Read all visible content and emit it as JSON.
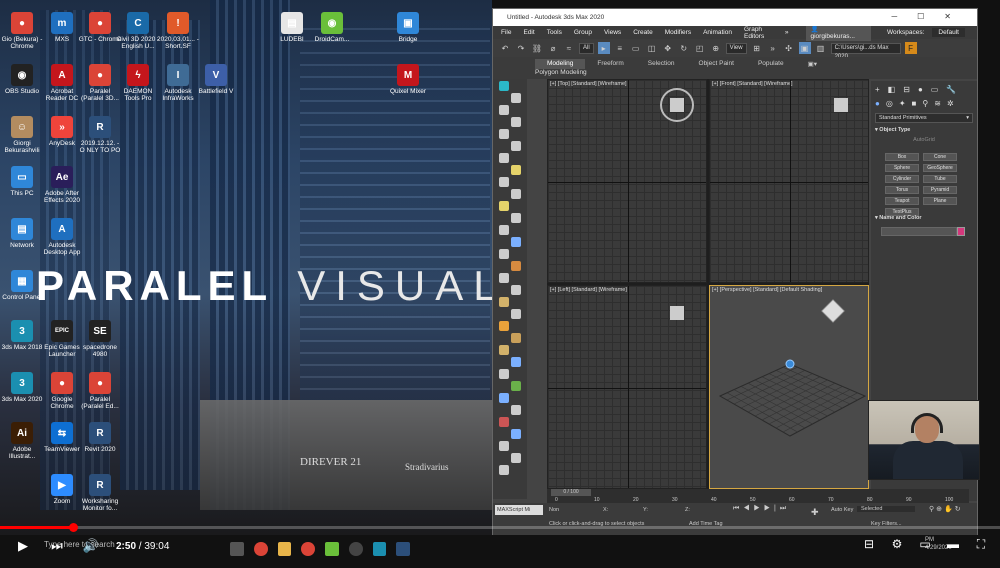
{
  "desktop": {
    "hero_bold": "PARALEL",
    "hero_thin": "VISUAL",
    "storefront_1": "DIREVER 21",
    "storefront_2": "Stradivarius",
    "icons": [
      {
        "label": "Gio (Bekura) - Chrome",
        "glyph": "●",
        "color": "#db4437"
      },
      {
        "label": "MXS",
        "glyph": "m",
        "color": "#1f6fbf"
      },
      {
        "label": "GTC - Chrome",
        "glyph": "●",
        "color": "#db4437"
      },
      {
        "label": "Civil 3D 2020 - English U...",
        "glyph": "C",
        "color": "#1a6aa8"
      },
      {
        "label": "2020.03.01... - Short.SF",
        "glyph": "!",
        "color": "#e05a2a"
      },
      {
        "label": "OBS Studio",
        "glyph": "◉",
        "color": "#222"
      },
      {
        "label": "Acrobat Reader DC",
        "glyph": "A",
        "color": "#c4161c"
      },
      {
        "label": "Paralel (Paralel 3D...",
        "glyph": "●",
        "color": "#db4437"
      },
      {
        "label": "DAEMON Tools Pro",
        "glyph": "ϟ",
        "color": "#c4161c"
      },
      {
        "label": "Autodesk InfraWorks",
        "glyph": "I",
        "color": "#3f6b95"
      },
      {
        "label": "Battlefield V",
        "glyph": "V",
        "color": "#3d5fa8"
      },
      {
        "label": "Giorgi Bekurashvili",
        "glyph": "☺",
        "color": "#b38c60"
      },
      {
        "label": "AnyDesk",
        "glyph": "»",
        "color": "#ef443b"
      },
      {
        "label": "2019.12.12. - O NLY TO PO",
        "glyph": "R",
        "color": "#2c4f7a"
      },
      {
        "label": "This PC",
        "glyph": "▭",
        "color": "#2f87d8"
      },
      {
        "label": "Adobe After Effects 2020",
        "glyph": "Ae",
        "color": "#2a1e5a"
      },
      {
        "label": "Network",
        "glyph": "▤",
        "color": "#2f87d8"
      },
      {
        "label": "Autodesk Desktop App",
        "glyph": "A",
        "color": "#1f6fbf"
      },
      {
        "label": "Control Panel",
        "glyph": "▦",
        "color": "#2f87d8"
      },
      {
        "label": "3ds Max 2018",
        "glyph": "3",
        "color": "#1b8fb0"
      },
      {
        "label": "Epic Games Launcher",
        "glyph": "EPIC",
        "color": "#222"
      },
      {
        "label": "spacedrone 4980",
        "glyph": "SE",
        "color": "#222"
      },
      {
        "label": "3ds Max 2020",
        "glyph": "3",
        "color": "#1b8fb0"
      },
      {
        "label": "Google Chrome",
        "glyph": "●",
        "color": "#db4437"
      },
      {
        "label": "Paralel (Paralel Ed...",
        "glyph": "●",
        "color": "#db4437"
      },
      {
        "label": "Adobe Illustrat...",
        "glyph": "Ai",
        "color": "#3b1e05"
      },
      {
        "label": "TeamViewer",
        "glyph": "⇆",
        "color": "#0e6fd2"
      },
      {
        "label": "Revit 2020",
        "glyph": "R",
        "color": "#2c4f7a"
      },
      {
        "label": "Zoom",
        "glyph": "▶",
        "color": "#2d8cff"
      },
      {
        "label": "Worksharing Monitor fo...",
        "glyph": "R",
        "color": "#2c4f7a"
      },
      {
        "label": "LUDEBI",
        "glyph": "▤",
        "color": "#e6e6e6"
      },
      {
        "label": "DroidCam...",
        "glyph": "◉",
        "color": "#6abf3a"
      },
      {
        "label": "Bridge",
        "glyph": "▣",
        "color": "#2f87d8"
      },
      {
        "label": "Quixel Mixer",
        "glyph": "M",
        "color": "#c4161c"
      }
    ]
  },
  "max": {
    "title": "Untitled - Autodesk 3ds Max 2020",
    "menus": [
      "File",
      "Edit",
      "Tools",
      "Group",
      "Views",
      "Create",
      "Modifiers",
      "Animation",
      "Graph Editors"
    ],
    "account": "giorgibekuras...",
    "workspace_label": "Workspaces:",
    "workspace_value": "Default",
    "path": "C:\\Users\\gi...ds Max 2020",
    "select_filter": "All",
    "view_dropdown": "View",
    "ribbon_tabs": [
      "Modeling",
      "Freeform",
      "Selection",
      "Object Paint",
      "Populate"
    ],
    "ribbon_sub": "Polygon Modeling",
    "viewports": {
      "top": "[+] [Top] [Standard] [Wireframe]",
      "front": "[+] [Front] [Standard] [Wireframe]",
      "left": "[+] [Left] [Standard] [Wireframe]",
      "persp": "[+] [Perspective] [Standard] [Default Shading]"
    },
    "panel": {
      "dropdown": "Standard Primitives",
      "rollout_object": "Object Type",
      "autogrid": "AutoGrid",
      "buttons": [
        "Box",
        "Cone",
        "Sphere",
        "GeoSphere",
        "Cylinder",
        "Tube",
        "Torus",
        "Pyramid",
        "Teapot",
        "Plane",
        "TextPlus"
      ],
      "rollout_name": "Name and Color",
      "swatch": "#d4387c"
    },
    "timeline": {
      "counter": "0 / 100",
      "ticks": [
        "0",
        "10",
        "20",
        "30",
        "40",
        "50",
        "60",
        "70",
        "80",
        "90",
        "100"
      ]
    },
    "status": {
      "script": "MAXScript Mi",
      "hint": "Click or click-and-drag to select objects",
      "none": "Non",
      "x": "X:",
      "y": "Y:",
      "z": "Z:",
      "add_time_tag": "Add Time Tag",
      "auto_key": "Auto Key",
      "selected": "Selected",
      "key_filters": "Key Filters..."
    }
  },
  "player": {
    "time_current": "2:50",
    "time_total": "39:04",
    "time_sep": " / ",
    "played_fraction": 0.073,
    "search_hint": "Type here to search",
    "clock": "PM\n4/29/2020"
  }
}
